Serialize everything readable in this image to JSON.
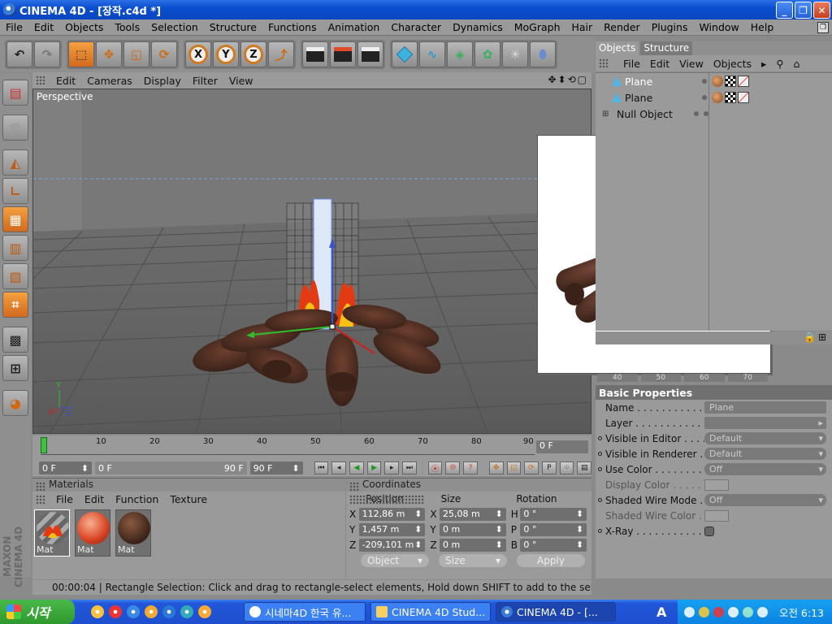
{
  "window": {
    "title": "CINEMA 4D - [장작.c4d *]"
  },
  "menubar": [
    "File",
    "Edit",
    "Objects",
    "Tools",
    "Selection",
    "Structure",
    "Functions",
    "Animation",
    "Character",
    "Dynamics",
    "MoGraph",
    "Hair",
    "Render",
    "Plugins",
    "Window",
    "Help"
  ],
  "toolbar": {
    "axis_x": "X",
    "axis_y": "Y",
    "axis_z": "Z"
  },
  "viewport": {
    "menu": [
      "Edit",
      "Cameras",
      "Display",
      "Filter",
      "View"
    ],
    "camera_label": "Perspective",
    "controls": "✥⬍⟲▢"
  },
  "timeline": {
    "ticks": [
      "0",
      "10",
      "20",
      "30",
      "40",
      "50",
      "60",
      "70",
      "80",
      "90"
    ],
    "current_frame": "0 F"
  },
  "playback": {
    "start": "0 F",
    "range_start": "0 F",
    "range_end": "90 F",
    "end": "90 F"
  },
  "materials": {
    "title": "Materials",
    "menu": [
      "File",
      "Edit",
      "Function",
      "Texture"
    ],
    "items": [
      {
        "label": "Mat"
      },
      {
        "label": "Mat"
      },
      {
        "label": "Mat"
      }
    ]
  },
  "coordinates": {
    "title": "Coordinates",
    "headers": [
      "Position",
      "Size",
      "Rotation"
    ],
    "rows": [
      {
        "pos_axis": "X",
        "pos": "112,86 m",
        "size_axis": "X",
        "size": "25,08 m",
        "rot_axis": "H",
        "rot": "0 °"
      },
      {
        "pos_axis": "Y",
        "pos": "1,457 m",
        "size_axis": "Y",
        "size": "0 m",
        "rot_axis": "P",
        "rot": "0 °"
      },
      {
        "pos_axis": "Z",
        "pos": "-209,101 m",
        "size_axis": "Z",
        "size": "0 m",
        "rot_axis": "B",
        "rot": "0 °"
      }
    ],
    "mode": "Object",
    "size_mode": "Size",
    "apply": "Apply"
  },
  "status": "00:00:04 | Rectangle Selection: Click and drag to rectangle-select elements, Hold down SHIFT to add to the selection,",
  "objects": {
    "tabs": [
      "Objects",
      "Structure"
    ],
    "menu": [
      "File",
      "Edit",
      "View",
      "Objects"
    ],
    "items": [
      {
        "name": "Plane",
        "selected": true
      },
      {
        "name": "Plane",
        "selected": false
      },
      {
        "name": "Null Object",
        "selected": false
      }
    ]
  },
  "attributes": {
    "tabs": [
      "40",
      "50",
      "60",
      "70"
    ],
    "section": "Basic Properties",
    "rows": [
      {
        "label": "Name . . . . . . . . . . . . .",
        "value": "Plane"
      },
      {
        "label": "Layer . . . . . . . . . . . . .",
        "value": ""
      },
      {
        "label": "Visible in Editor . . . . .",
        "value": "Default"
      },
      {
        "label": "Visible in Renderer . . .",
        "value": "Default"
      },
      {
        "label": "Use Color . . . . . . . . . .",
        "value": "Off"
      },
      {
        "label": "Display Color . . . . . . .",
        "value": ""
      },
      {
        "label": "Shaded Wire Mode . .",
        "value": "Off"
      },
      {
        "label": "Shaded Wire Color . .",
        "value": ""
      },
      {
        "label": "X-Ray . . . . . . . . . . . . .",
        "value": ""
      }
    ]
  },
  "taskbar": {
    "start": "시작",
    "tasks": [
      "시네마4D 한국 유...",
      "CINEMA 4D Stud...",
      "CINEMA 4D - [..."
    ],
    "ime": "A",
    "clock": "오전 6:13"
  },
  "branding": {
    "maxon": "MAXON CINEMA 4D"
  }
}
